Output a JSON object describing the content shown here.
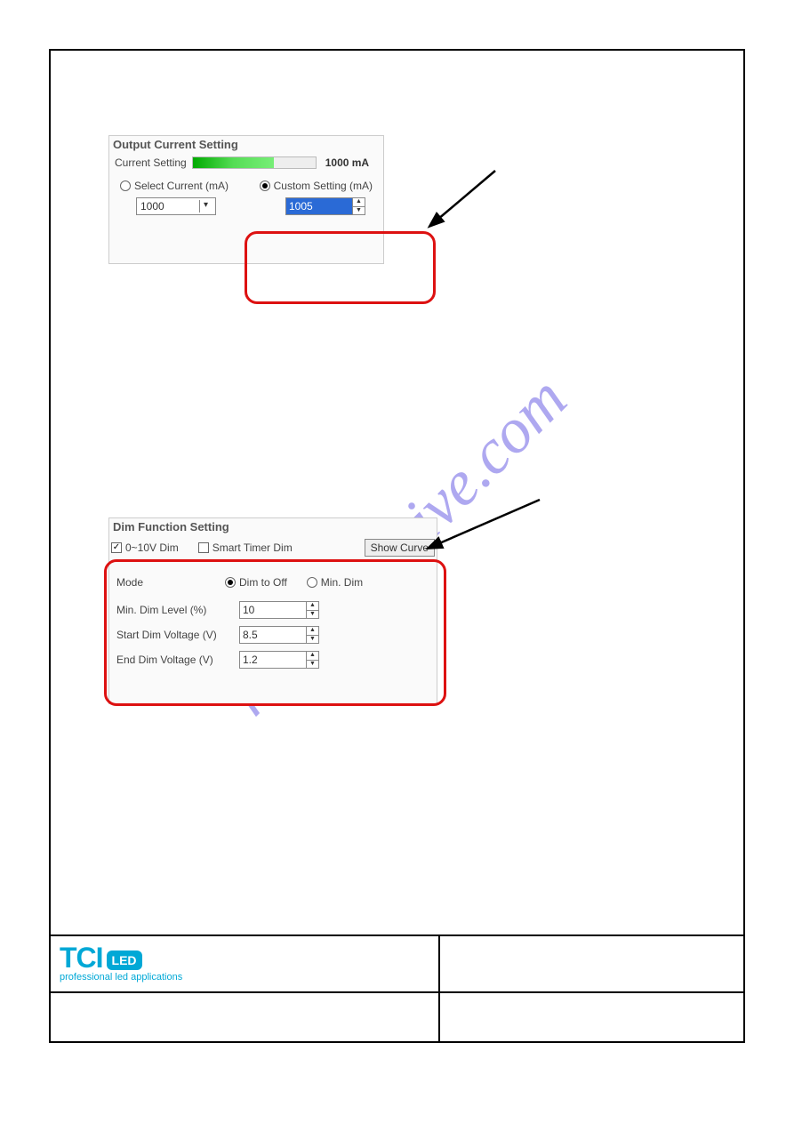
{
  "watermark": "manualshive.com",
  "panel1": {
    "title": "Output Current Setting",
    "current_setting_label": "Current Setting",
    "current_value_text": "1000 mA",
    "select_current_label": "Select Current (mA)",
    "select_current_value": "1000",
    "custom_setting_label": "Custom Setting (mA)",
    "custom_setting_value": "1005"
  },
  "panel2": {
    "title": "Dim Function Setting",
    "chk_0_10v": "0~10V Dim",
    "chk_smart": "Smart Timer Dim",
    "show_curve": "Show Curve",
    "mode_label": "Mode",
    "mode_dim_to_off": "Dim to Off",
    "mode_min_dim": "Min. Dim",
    "min_dim_level_label": "Min. Dim Level (%)",
    "min_dim_level_value": "10",
    "start_dim_voltage_label": "Start Dim Voltage (V)",
    "start_dim_voltage_value": "8.5",
    "end_dim_voltage_label": "End Dim Voltage (V)",
    "end_dim_voltage_value": "1.2"
  },
  "footer": {
    "logo_text": "TCI",
    "logo_badge": "LED",
    "logo_sub": "professional led applications"
  }
}
